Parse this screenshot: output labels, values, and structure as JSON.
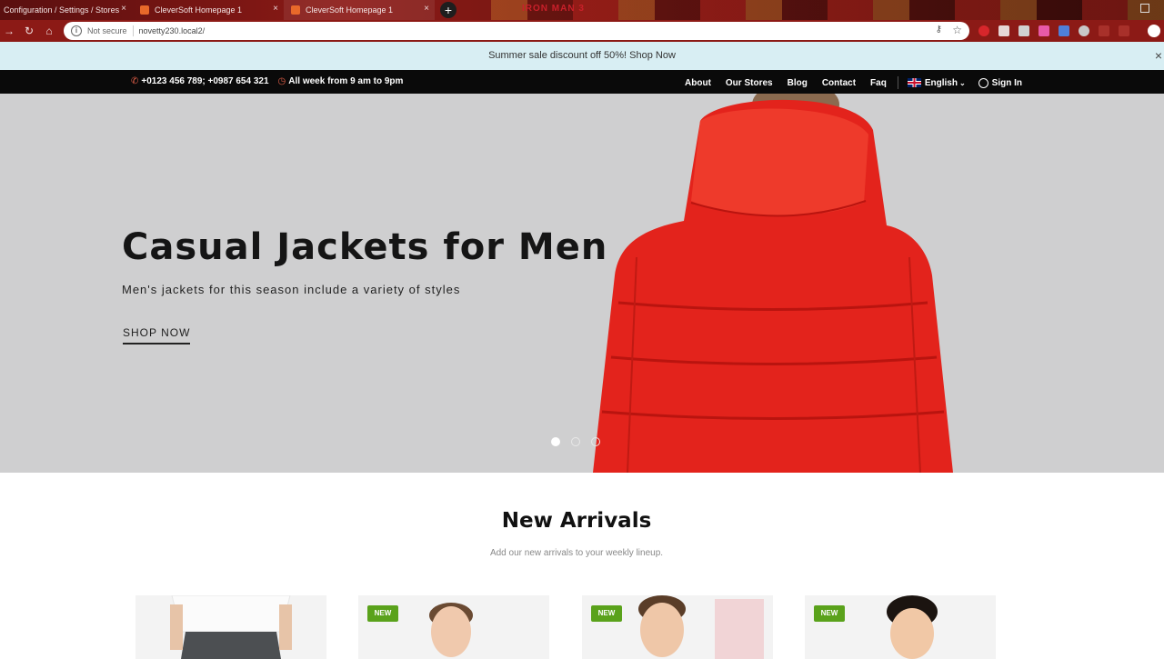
{
  "browser": {
    "tabs": [
      {
        "title": "Configuration / Settings / Stores"
      },
      {
        "title": "CleverSoft Homepage 1"
      },
      {
        "title": "CleverSoft Homepage 1"
      }
    ],
    "tab_close": "×",
    "new_tab": "+",
    "security_label": "Not secure",
    "url": "novetty230.local2/",
    "banner_text": "IRON MAN 3"
  },
  "promo": {
    "text": "Summer sale discount off 50%! Shop Now",
    "close": "×"
  },
  "topbar": {
    "phone": "+0123 456 789; +0987 654 321",
    "hours": "All week from 9 am to 9pm",
    "nav": [
      "About",
      "Our Stores",
      "Blog",
      "Contact",
      "Faq"
    ],
    "language": "English",
    "sign_in": "Sign In"
  },
  "hero": {
    "title": "Casual Jackets for Men",
    "subtitle": "Men's jackets for this season include a variety of styles",
    "cta": "SHOP NOW",
    "slide_count": 3,
    "active_slide": 1
  },
  "new_arrivals": {
    "title": "New Arrivals",
    "subtitle": "Add our new arrivals to your weekly lineup.",
    "badge": "NEW",
    "products": [
      {
        "badge": false
      },
      {
        "badge": true
      },
      {
        "badge": true
      },
      {
        "badge": true
      }
    ]
  },
  "colors": {
    "accent": "#e8614a",
    "badge": "#5aa21b",
    "jacket": "#e3231c",
    "promo_bg": "#d8eef3"
  }
}
